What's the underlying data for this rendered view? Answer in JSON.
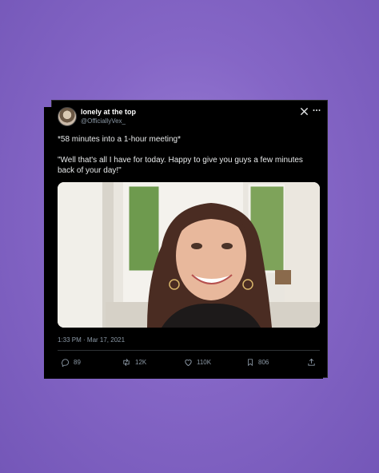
{
  "tweet": {
    "display_name": "lonely at the top",
    "handle": "@OfficiallyVex_",
    "text_line1": "*58 minutes into a 1-hour meeting*",
    "text_line2": "\"Well that's all I have for today. Happy to give you guys a few minutes back of your day!\"",
    "timestamp": "1:33 PM · Mar 17, 2021",
    "replies": "89",
    "retweets": "12K",
    "likes": "110K",
    "bookmarks": "806"
  },
  "colors": {
    "background": "#8566c6",
    "card": "#000000",
    "muted_text": "#8b98a5"
  },
  "icons": [
    "x-logo-icon",
    "more-icon",
    "reply-icon",
    "retweet-icon",
    "like-icon",
    "bookmark-icon",
    "share-icon"
  ]
}
